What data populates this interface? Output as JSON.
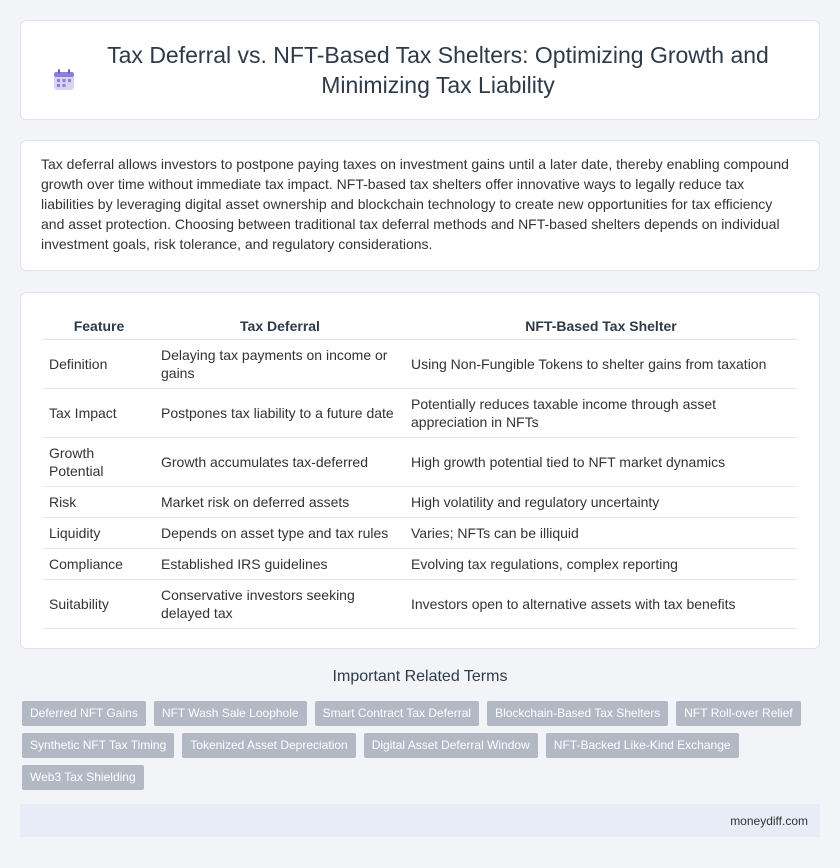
{
  "header": {
    "title": "Tax Deferral vs. NFT-Based Tax Shelters: Optimizing Growth and Minimizing Tax Liability",
    "icon": "calendar-icon"
  },
  "intro": {
    "text": "Tax deferral allows investors to postpone paying taxes on investment gains until a later date, thereby enabling compound growth over time without immediate tax impact. NFT-based tax shelters offer innovative ways to legally reduce tax liabilities by leveraging digital asset ownership and blockchain technology to create new opportunities for tax efficiency and asset protection. Choosing between traditional tax deferral methods and NFT-based shelters depends on individual investment goals, risk tolerance, and regulatory considerations."
  },
  "table": {
    "headers": [
      "Feature",
      "Tax Deferral",
      "NFT-Based Tax Shelter"
    ],
    "rows": [
      [
        "Definition",
        "Delaying tax payments on income or gains",
        "Using Non-Fungible Tokens to shelter gains from taxation"
      ],
      [
        "Tax Impact",
        "Postpones tax liability to a future date",
        "Potentially reduces taxable income through asset appreciation in NFTs"
      ],
      [
        "Growth Potential",
        "Growth accumulates tax-deferred",
        "High growth potential tied to NFT market dynamics"
      ],
      [
        "Risk",
        "Market risk on deferred assets",
        "High volatility and regulatory uncertainty"
      ],
      [
        "Liquidity",
        "Depends on asset type and tax rules",
        "Varies; NFTs can be illiquid"
      ],
      [
        "Compliance",
        "Established IRS guidelines",
        "Evolving tax regulations, complex reporting"
      ],
      [
        "Suitability",
        "Conservative investors seeking delayed tax",
        "Investors open to alternative assets with tax benefits"
      ]
    ]
  },
  "related": {
    "title": "Important Related Terms",
    "tags": [
      "Deferred NFT Gains",
      "NFT Wash Sale Loophole",
      "Smart Contract Tax Deferral",
      "Blockchain-Based Tax Shelters",
      "NFT Roll-over Relief",
      "Synthetic NFT Tax Timing",
      "Tokenized Asset Depreciation",
      "Digital Asset Deferral Window",
      "NFT-Backed Like-Kind Exchange",
      "Web3 Tax Shielding"
    ]
  },
  "footer": {
    "site": "moneydiff.com"
  },
  "colors": {
    "background": "#f3f4f8",
    "tag": "#b2b9c4",
    "footer": "#e8ecf6",
    "icon": "#8b7fd6"
  }
}
